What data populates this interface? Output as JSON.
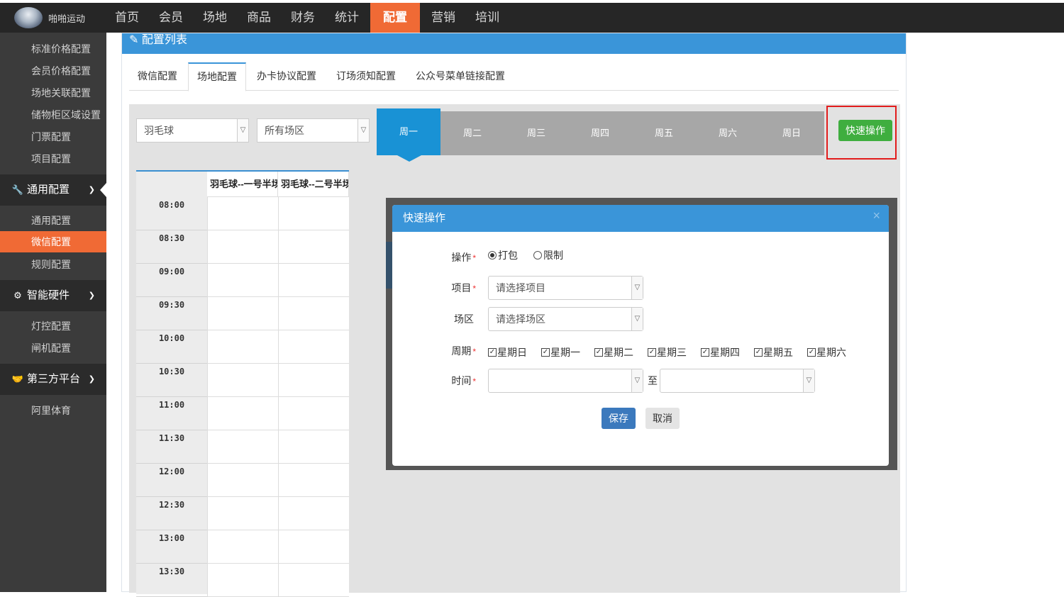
{
  "app": {
    "name": "啪啪运动"
  },
  "nav": {
    "items": [
      "首页",
      "会员",
      "场地",
      "商品",
      "财务",
      "统计",
      "配置",
      "营销",
      "培训"
    ],
    "active": "配置"
  },
  "sidebar": {
    "items_top": [
      "标准价格配置",
      "会员价格配置",
      "场地关联配置",
      "储物柜区域设置",
      "门票配置",
      "项目配置"
    ],
    "group_general": {
      "label": "通用配置",
      "icon": "wrench-icon"
    },
    "items_general": [
      "通用配置",
      "微信配置",
      "规则配置"
    ],
    "active_item": "微信配置",
    "group_hardware": {
      "label": "智能硬件",
      "icon": "gear-icon"
    },
    "items_hardware": [
      "灯控配置",
      "闸机配置"
    ],
    "group_third": {
      "label": "第三方平台",
      "icon": "handshake-icon"
    },
    "items_third": [
      "阿里体育"
    ]
  },
  "panel": {
    "title": "配置列表",
    "tabs": [
      "微信配置",
      "场地配置",
      "办卡协议配置",
      "订场须知配置",
      "公众号菜单链接配置"
    ],
    "active_tab": "场地配置"
  },
  "filters": {
    "sport": "羽毛球",
    "area": "所有场区"
  },
  "weekdays": [
    "周一",
    "周二",
    "周三",
    "周四",
    "周五",
    "周六",
    "周日"
  ],
  "active_weekday": "周一",
  "quick_button": "快速操作",
  "grid": {
    "columns": [
      "羽毛球--一号半场",
      "羽毛球--二号半场"
    ],
    "times": [
      "08:00",
      "08:30",
      "09:00",
      "09:30",
      "10:00",
      "10:30",
      "11:00",
      "11:30",
      "12:00",
      "12:30",
      "13:00",
      "13:30"
    ]
  },
  "modal": {
    "title": "快速操作",
    "close": "×",
    "op_label": "操作",
    "op_options": [
      "打包",
      "限制"
    ],
    "op_selected": "打包",
    "project_label": "项目",
    "project_placeholder": "请选择项目",
    "area_label": "场区",
    "area_placeholder": "请选择场区",
    "week_label": "周期",
    "week_options": [
      "星期日",
      "星期一",
      "星期二",
      "星期三",
      "星期四",
      "星期五",
      "星期六"
    ],
    "time_label": "时间",
    "time_sep": "至",
    "save": "保存",
    "cancel": "取消",
    "required_mark": "*"
  }
}
